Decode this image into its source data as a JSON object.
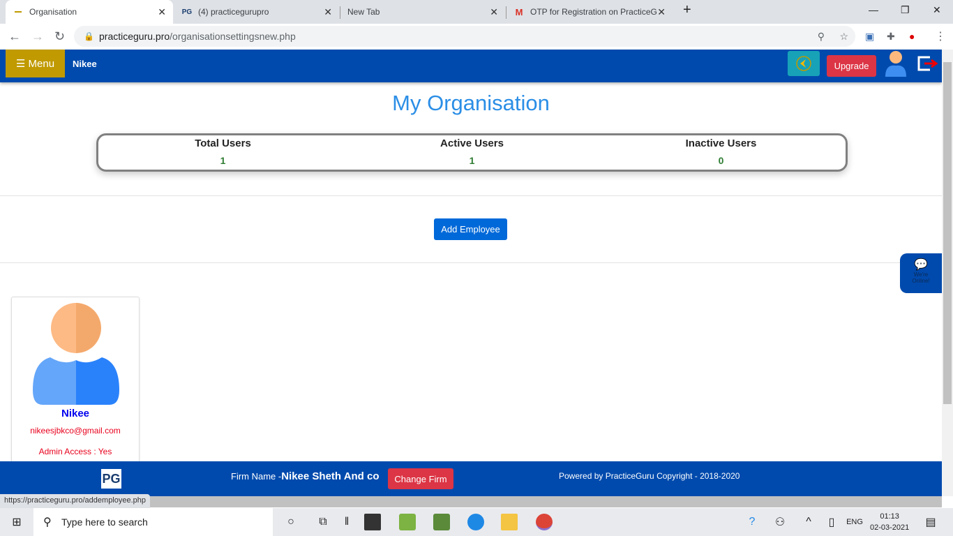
{
  "browser": {
    "tabs": [
      {
        "title": "Organisation",
        "active": true
      },
      {
        "title": "(4) practicegurupro"
      },
      {
        "title": "New Tab"
      },
      {
        "title": "OTP for Registration on PracticeG"
      }
    ],
    "url_host": "practiceguru.pro",
    "url_path": "/organisationsettingsnew.php",
    "status_url": "https://practiceguru.pro/addemployee.php"
  },
  "header": {
    "menu_label": "☰ Menu",
    "user_name": "Nikee",
    "upgrade_label": "Upgrade"
  },
  "page": {
    "title": "My Organisation",
    "stats": [
      {
        "label": "Total Users",
        "value": "1"
      },
      {
        "label": "Active Users",
        "value": "1"
      },
      {
        "label": "Inactive Users",
        "value": "0"
      }
    ],
    "add_employee_label": "Add Employee",
    "chat": {
      "line1": "We're",
      "line2": "Online!"
    }
  },
  "employees": [
    {
      "name": "Nikee",
      "email": "nikeesjbkco@gmail.com",
      "admin": "Admin Access : Yes"
    }
  ],
  "footer": {
    "logo": "PG",
    "firm_prefix": "Firm Name -",
    "firm_name": "Nikee Sheth And co",
    "change_firm_label": "Change Firm",
    "powered": "Powered by PracticeGuru Copyright - 2018-2020"
  },
  "taskbar": {
    "search_placeholder": "Type here to search",
    "lang": "ENG",
    "time": "01:13",
    "date": "02-03-2021"
  },
  "colors": {
    "brand": "#004aad",
    "accent": "#2b8ee6",
    "danger": "#dc3545",
    "menu": "#c09a00"
  }
}
